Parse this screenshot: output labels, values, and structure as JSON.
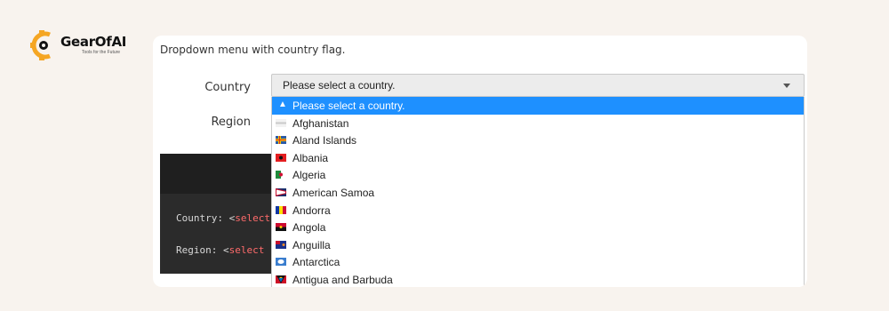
{
  "brand": {
    "name": "GearOfAI",
    "tagline": "Tools for the Future"
  },
  "page": {
    "description": "Dropdown menu with country flag."
  },
  "form": {
    "country_label": "Country",
    "region_label": "Region",
    "country_select": {
      "selected": "Please select a country.",
      "options": [
        {
          "label": "Please select a country.",
          "flag": "chevron-up-icon"
        },
        {
          "label": "Afghanistan",
          "flag": "afghanistan-flag-icon"
        },
        {
          "label": "Aland Islands",
          "flag": "aland-islands-flag-icon"
        },
        {
          "label": "Albania",
          "flag": "albania-flag-icon"
        },
        {
          "label": "Algeria",
          "flag": "algeria-flag-icon"
        },
        {
          "label": "American Samoa",
          "flag": "american-samoa-flag-icon"
        },
        {
          "label": "Andorra",
          "flag": "andorra-flag-icon"
        },
        {
          "label": "Angola",
          "flag": "angola-flag-icon"
        },
        {
          "label": "Anguilla",
          "flag": "anguilla-flag-icon"
        },
        {
          "label": "Antarctica",
          "flag": "antarctica-flag-icon"
        },
        {
          "label": "Antigua and Barbuda",
          "flag": "antigua-and-barbuda-flag-icon"
        }
      ]
    }
  },
  "code_sample": {
    "line1_prefix": "Country: <",
    "line1_tag": "select",
    "line2_prefix": "Region: <",
    "line2_tag": "select"
  },
  "colors": {
    "accent": "#1e90ff",
    "logo_orange": "#f5a623",
    "code_bg": "#2b2b2b",
    "code_keyword": "#ff6b6b"
  }
}
